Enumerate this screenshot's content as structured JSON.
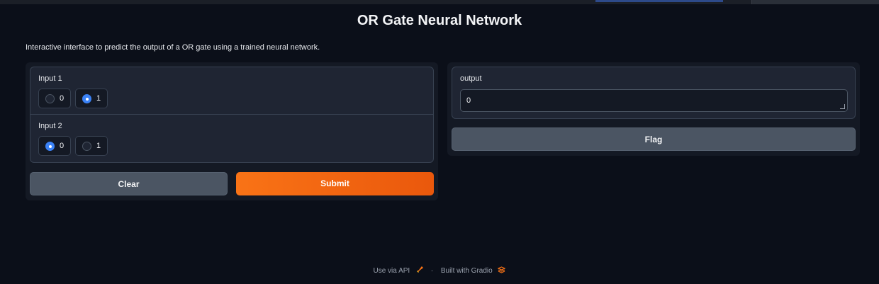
{
  "page": {
    "title": "OR Gate Neural Network",
    "description": "Interactive interface to predict the output of a OR gate using a trained neural network."
  },
  "inputs": {
    "input1": {
      "label": "Input 1",
      "options": [
        "0",
        "1"
      ],
      "selected": "1"
    },
    "input2": {
      "label": "Input 2",
      "options": [
        "0",
        "1"
      ],
      "selected": "0"
    }
  },
  "buttons": {
    "clear": "Clear",
    "submit": "Submit",
    "flag": "Flag"
  },
  "output": {
    "label": "output",
    "value": "0"
  },
  "footer": {
    "api_link": "Use via API",
    "separator": "·",
    "built_with": "Built with Gradio"
  },
  "colors": {
    "background": "#0b0f19",
    "accent": "#f97316",
    "radio_selected": "#3b82f6"
  },
  "icons": {
    "api": "rocket-icon",
    "gradio": "gradio-logo-icon"
  }
}
